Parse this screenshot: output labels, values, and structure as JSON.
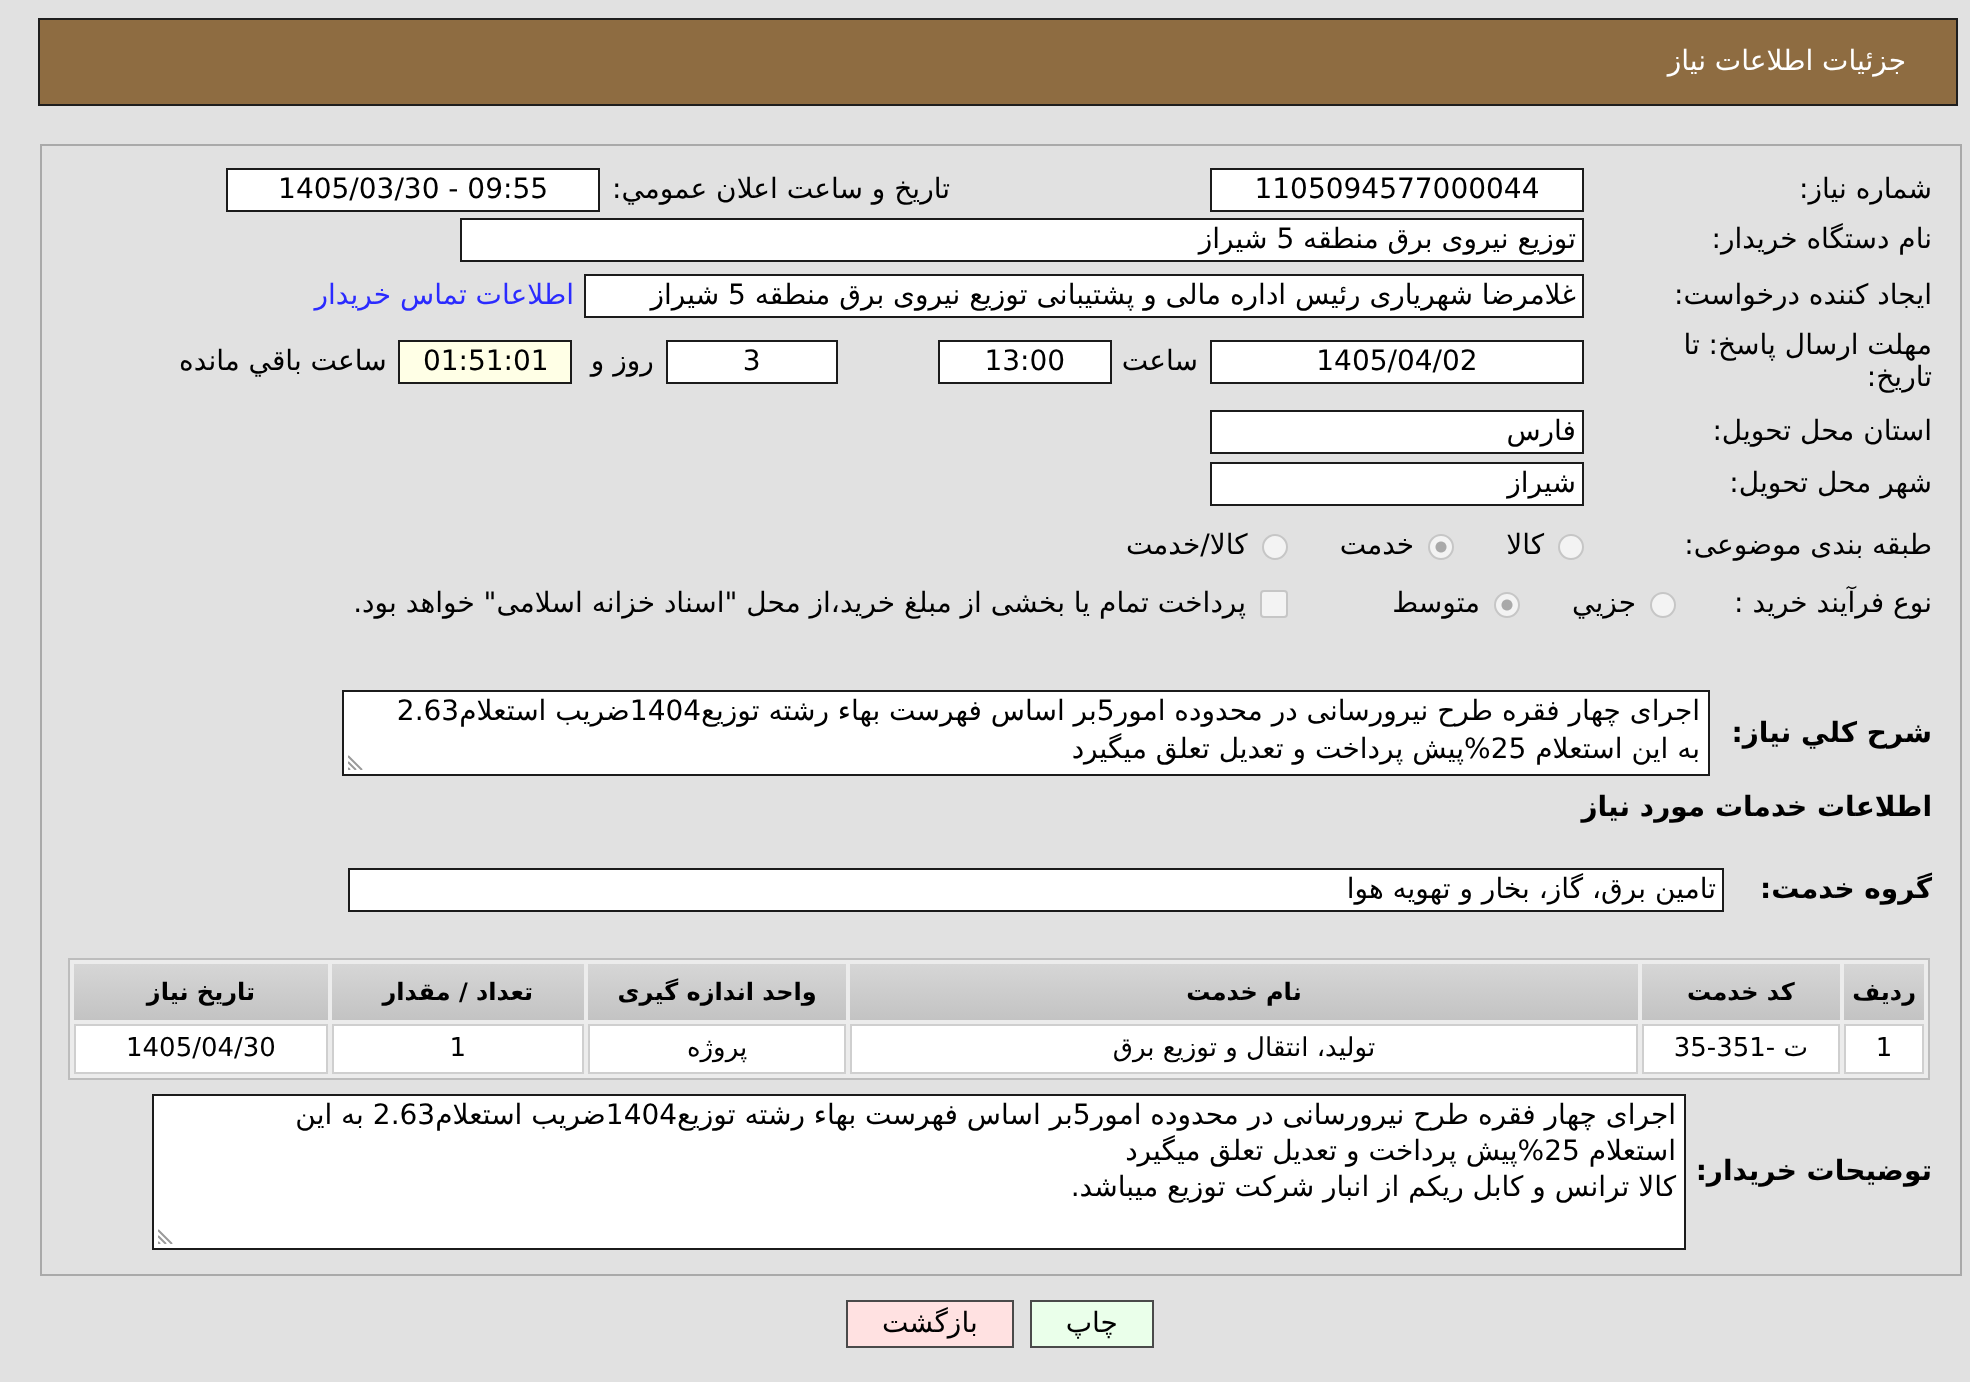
{
  "header": {
    "title": "جزئیات اطلاعات نیاز"
  },
  "form": {
    "need_number": {
      "label": "شماره نیاز:",
      "value": "1105094577000044"
    },
    "announce_datetime": {
      "label": "تاریخ و ساعت اعلان عمومي:",
      "value": "1405/03/30 - 09:55"
    },
    "buyer_org": {
      "label": "نام دستگاه خریدار:",
      "value": "توزیع نیروی برق منطقه 5 شیراز"
    },
    "requester": {
      "label": "ایجاد کننده درخواست:",
      "value": "غلامرضا شهریاری رئیس اداره مالی و پشتیبانی توزیع نیروی برق منطقه 5 شیراز",
      "link": "اطلاعات تماس خریدار"
    },
    "deadline": {
      "label": "مهلت ارسال پاسخ: تا تاریخ:",
      "date": "1405/04/02",
      "time_label": "ساعت",
      "time": "13:00",
      "days": "3",
      "days_label": "روز و",
      "remaining": "01:51:01",
      "remaining_label": "ساعت باقي مانده"
    },
    "province": {
      "label": "استان محل تحویل:",
      "value": "فارس"
    },
    "city": {
      "label": "شهر محل تحویل:",
      "value": "شیراز"
    },
    "category": {
      "label": "طبقه بندی موضوعی:",
      "disabled": true,
      "options": [
        {
          "label": "کالا",
          "selected": false
        },
        {
          "label": "خدمت",
          "selected": true
        },
        {
          "label": "کالا/خدمت",
          "selected": false
        }
      ]
    },
    "process": {
      "label": "نوع فرآیند خرید :",
      "disabled": true,
      "options": [
        {
          "label": "جزيي",
          "selected": false
        },
        {
          "label": "متوسط",
          "selected": true
        }
      ],
      "treasury": {
        "label": "پرداخت تمام یا بخشی از مبلغ خرید،از محل \"اسناد خزانه اسلامی\" خواهد بود.",
        "checked": false
      }
    }
  },
  "description": {
    "label": "شرح کلي نیاز:",
    "value": "اجرای چهار فقره طرح نیرورسانی در محدوده امور5بر اساس فهرست بهاء رشته توزیع1404ضریب استعلام2.63 به این استعلام 25%پیش پرداخت و تعدیل تعلق میگیرد"
  },
  "services": {
    "title": "اطلاعات خدمات مورد نیاز",
    "group_label": "گروه خدمت:",
    "group": "تامین برق، گاز، بخار و تهویه هوا",
    "table": {
      "columns": [
        "ردیف",
        "کد خدمت",
        "نام خدمت",
        "واحد اندازه گیری",
        "تعداد / مقدار",
        "تاریخ نیاز"
      ],
      "rows": [
        [
          "1",
          "ت -351-35",
          "تولید، انتقال و توزیع برق",
          "پروژه",
          "1",
          "1405/04/30"
        ]
      ]
    }
  },
  "buyer_notes": {
    "label": "توضیحات خریدار:",
    "value": "اجرای چهار فقره طرح نیرورسانی در محدوده امور5بر اساس فهرست بهاء رشته توزیع1404ضریب استعلام2.63 به این استعلام 25%پیش پرداخت و تعدیل تعلق میگیرد\nکالا ترانس و کابل ریکم از انبار شرکت توزیع میباشد."
  },
  "buttons": [
    {
      "label": "چاپ",
      "kind": "print"
    },
    {
      "label": "بازگشت",
      "kind": "back"
    }
  ]
}
